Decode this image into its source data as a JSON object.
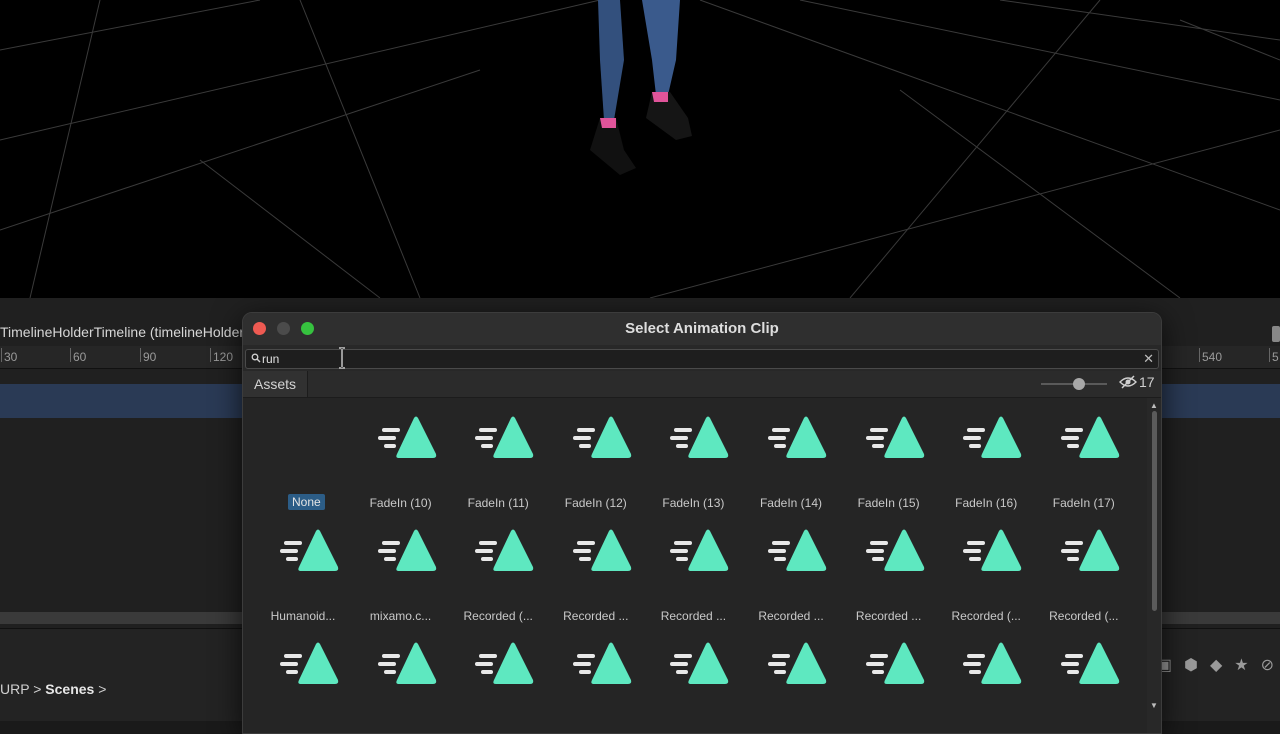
{
  "timeline": {
    "header_title": "TimelineHolderTimeline (timelineHolder",
    "ruler_ticks_left": [
      "30",
      "60",
      "90",
      "120"
    ],
    "ruler_ticks_right": [
      "540",
      "5"
    ]
  },
  "project": {
    "breadcrumb": [
      "URP",
      "Scenes"
    ]
  },
  "dialog": {
    "title": "Select Animation Clip",
    "search_value": "run",
    "search_placeholder": "",
    "tab_label": "Assets",
    "hidden_count": "17",
    "items": [
      {
        "label": "None",
        "thumb": "none",
        "selected": true
      },
      {
        "label": "FadeIn (10)",
        "thumb": "animation-clip-icon"
      },
      {
        "label": "FadeIn (11)",
        "thumb": "animation-clip-icon"
      },
      {
        "label": "FadeIn (12)",
        "thumb": "animation-clip-icon"
      },
      {
        "label": "FadeIn (13)",
        "thumb": "animation-clip-icon"
      },
      {
        "label": "FadeIn (14)",
        "thumb": "animation-clip-icon"
      },
      {
        "label": "FadeIn (15)",
        "thumb": "animation-clip-icon"
      },
      {
        "label": "FadeIn (16)",
        "thumb": "animation-clip-icon"
      },
      {
        "label": "FadeIn (17)",
        "thumb": "animation-clip-icon"
      },
      {
        "label": "Humanoid...",
        "thumb": "animation-clip-icon"
      },
      {
        "label": "mixamo.c...",
        "thumb": "animation-clip-icon"
      },
      {
        "label": "Recorded (...",
        "thumb": "animation-clip-icon"
      },
      {
        "label": "Recorded ...",
        "thumb": "animation-clip-icon"
      },
      {
        "label": "Recorded ...",
        "thumb": "animation-clip-icon"
      },
      {
        "label": "Recorded ...",
        "thumb": "animation-clip-icon"
      },
      {
        "label": "Recorded ...",
        "thumb": "animation-clip-icon"
      },
      {
        "label": "Recorded (...",
        "thumb": "animation-clip-icon"
      },
      {
        "label": "Recorded (...",
        "thumb": "animation-clip-icon"
      },
      {
        "label": "",
        "thumb": "animation-clip-icon"
      },
      {
        "label": "",
        "thumb": "animation-clip-icon"
      },
      {
        "label": "",
        "thumb": "animation-clip-icon"
      },
      {
        "label": "",
        "thumb": "animation-clip-icon"
      },
      {
        "label": "",
        "thumb": "animation-clip-icon"
      },
      {
        "label": "",
        "thumb": "animation-clip-icon"
      },
      {
        "label": "",
        "thumb": "animation-clip-icon"
      },
      {
        "label": "",
        "thumb": "animation-clip-icon"
      },
      {
        "label": "",
        "thumb": "animation-clip-icon"
      }
    ]
  },
  "colors": {
    "clip_icon": "#5ee8c0",
    "selection": "#2c5d87",
    "close": "#ee5a52",
    "maximize": "#36c23f"
  }
}
